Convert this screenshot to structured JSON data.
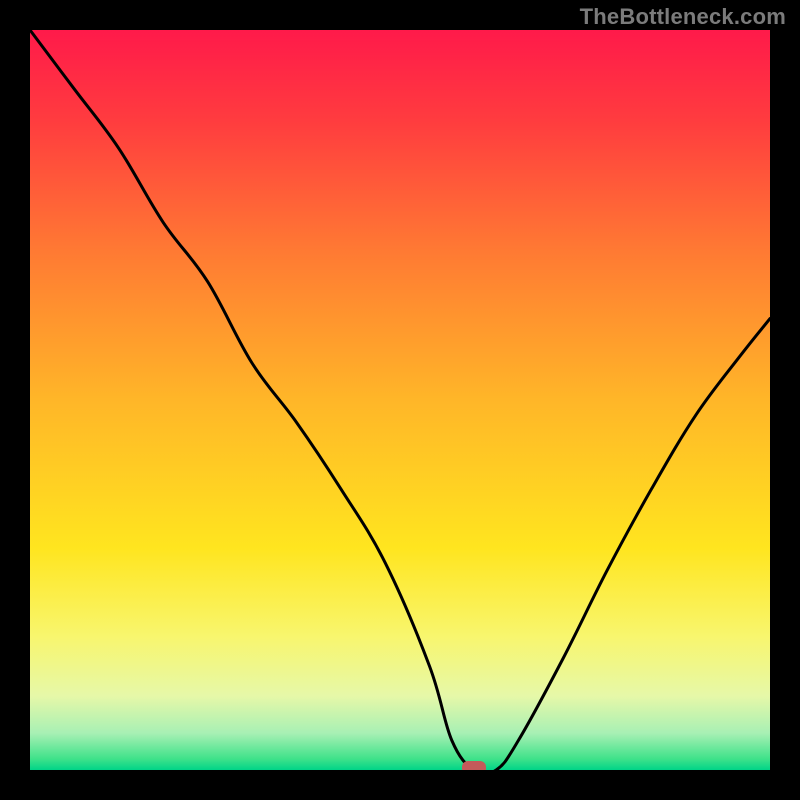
{
  "watermark": "TheBottleneck.com",
  "chart_data": {
    "type": "line",
    "title": "",
    "xlabel": "",
    "ylabel": "",
    "xlim": [
      0,
      100
    ],
    "ylim": [
      0,
      100
    ],
    "grid": false,
    "legend": false,
    "min_marker": {
      "x": 60,
      "y": 0,
      "color": "#c45a5a"
    },
    "background_gradient": [
      {
        "pos": 0.0,
        "color": "#ff1a4a"
      },
      {
        "pos": 0.12,
        "color": "#ff3b3f"
      },
      {
        "pos": 0.3,
        "color": "#ff7a33"
      },
      {
        "pos": 0.5,
        "color": "#ffb628"
      },
      {
        "pos": 0.7,
        "color": "#ffe51f"
      },
      {
        "pos": 0.82,
        "color": "#f8f66e"
      },
      {
        "pos": 0.9,
        "color": "#e6f8a8"
      },
      {
        "pos": 0.95,
        "color": "#a8f0b4"
      },
      {
        "pos": 0.985,
        "color": "#3fe28a"
      },
      {
        "pos": 1.0,
        "color": "#00d488"
      }
    ],
    "series": [
      {
        "name": "bottleneck-curve",
        "x": [
          0,
          6,
          12,
          18,
          24,
          30,
          36,
          42,
          48,
          54,
          57,
          60,
          63,
          66,
          72,
          78,
          84,
          90,
          96,
          100
        ],
        "y": [
          100,
          92,
          84,
          74,
          66,
          55,
          47,
          38,
          28,
          14,
          4,
          0,
          0,
          4,
          15,
          27,
          38,
          48,
          56,
          61
        ]
      }
    ]
  }
}
